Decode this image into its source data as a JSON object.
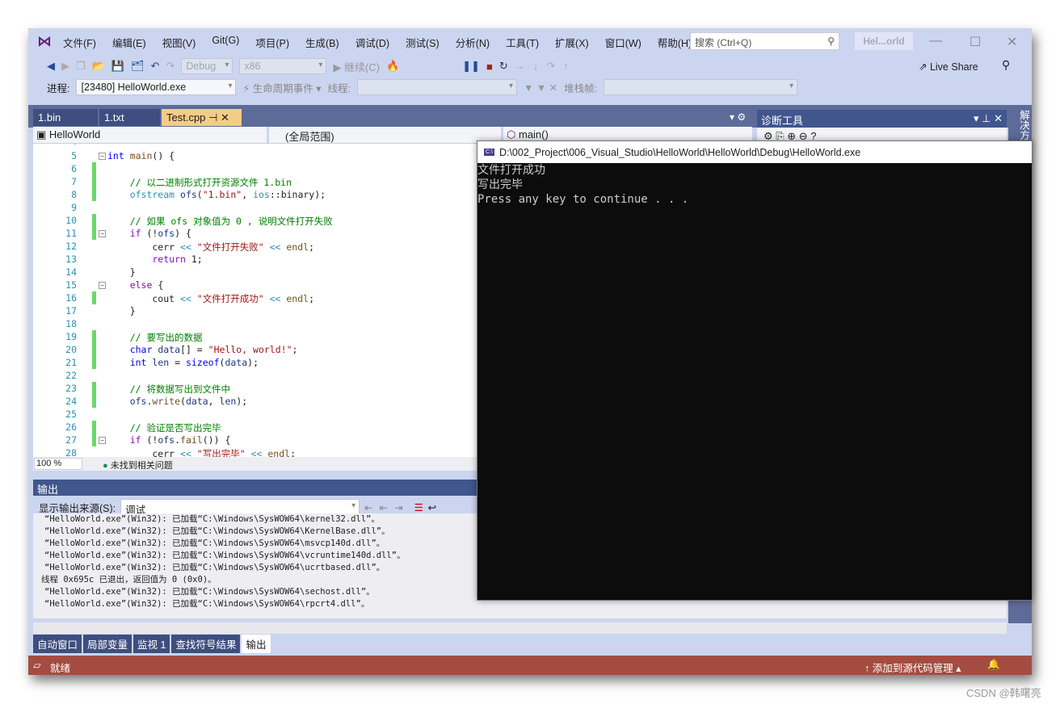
{
  "menu": [
    "文件(F)",
    "编辑(E)",
    "视图(V)",
    "Git(G)",
    "项目(P)",
    "生成(B)",
    "调试(D)",
    "测试(S)",
    "分析(N)",
    "工具(T)",
    "扩展(X)",
    "窗口(W)",
    "帮助(H)"
  ],
  "search": {
    "placeholder": "搜索 (Ctrl+Q)"
  },
  "window_title": "Hel...orld",
  "toolbar": {
    "config": "Debug",
    "platform": "x86",
    "continue": "继续(C)",
    "live_share": "Live Share"
  },
  "debug_bar": {
    "process_label": "进程:",
    "process": "[23480] HelloWorld.exe",
    "lifecycle": "生命周期事件",
    "thread_label": "线程:",
    "stack_label": "堆栈帧:"
  },
  "tabs": [
    {
      "label": "1.bin"
    },
    {
      "label": "1.txt"
    },
    {
      "label": "Test.cpp",
      "active": true
    }
  ],
  "nav": {
    "project": "HelloWorld",
    "scope": "(全局范围)",
    "member": "main()"
  },
  "code": [
    {
      "n": "5",
      "t": [
        [
          "kw",
          "int"
        ],
        [
          "",
          ""
        ],
        [
          "fn",
          " main"
        ],
        [
          "",
          "() {"
        ]
      ]
    },
    {
      "n": "6",
      "t": []
    },
    {
      "n": "7",
      "t": [
        [
          "cm",
          "    // 以二进制形式打开资源文件 1.bin"
        ]
      ]
    },
    {
      "n": "8",
      "t": [
        [
          "ty",
          "    ofstream"
        ],
        [
          "vr",
          " ofs"
        ],
        [
          "",
          "("
        ],
        [
          "st",
          "\"1.bin\""
        ],
        [
          "",
          ", "
        ],
        [
          "ty",
          "ios"
        ],
        [
          "",
          "::binary);"
        ]
      ]
    },
    {
      "n": "9",
      "t": []
    },
    {
      "n": "10",
      "t": [
        [
          "cm",
          "    // 如果 ofs 对象值为 0 , 说明文件打开失败"
        ]
      ]
    },
    {
      "n": "11",
      "t": [
        [
          "pp",
          "    if"
        ],
        [
          "",
          " (!"
        ],
        [
          "vr",
          "ofs"
        ],
        [
          "",
          ") {"
        ]
      ]
    },
    {
      "n": "12",
      "t": [
        [
          "",
          "        cerr "
        ],
        [
          "ty",
          "<<"
        ],
        [
          "st",
          " \"文件打开失败\""
        ],
        [
          "ty",
          " <<"
        ],
        [
          "fn",
          " endl"
        ],
        [
          "",
          ";"
        ]
      ]
    },
    {
      "n": "13",
      "t": [
        [
          "pp",
          "        return"
        ],
        [
          "",
          " 1;"
        ]
      ]
    },
    {
      "n": "14",
      "t": [
        [
          "",
          "    }"
        ]
      ]
    },
    {
      "n": "15",
      "t": [
        [
          "pp",
          "    else"
        ],
        [
          "",
          " {"
        ]
      ]
    },
    {
      "n": "16",
      "t": [
        [
          "",
          "        cout "
        ],
        [
          "ty",
          "<<"
        ],
        [
          "st",
          " \"文件打开成功\""
        ],
        [
          "ty",
          " <<"
        ],
        [
          "fn",
          " endl"
        ],
        [
          "",
          ";"
        ]
      ]
    },
    {
      "n": "17",
      "t": [
        [
          "",
          "    }"
        ]
      ]
    },
    {
      "n": "18",
      "t": []
    },
    {
      "n": "19",
      "t": [
        [
          "cm",
          "    // 要写出的数据"
        ]
      ]
    },
    {
      "n": "20",
      "t": [
        [
          "kw",
          "    char"
        ],
        [
          "vr",
          " data"
        ],
        [
          "",
          "[] = "
        ],
        [
          "st",
          "\"Hello, world!\""
        ],
        [
          "",
          ";"
        ]
      ]
    },
    {
      "n": "21",
      "t": [
        [
          "kw",
          "    int"
        ],
        [
          "vr",
          " len"
        ],
        [
          "",
          " = "
        ],
        [
          "kw",
          "sizeof"
        ],
        [
          "",
          "("
        ],
        [
          "vr",
          "data"
        ],
        [
          "",
          ");"
        ]
      ]
    },
    {
      "n": "22",
      "t": []
    },
    {
      "n": "23",
      "t": [
        [
          "cm",
          "    // 将数据写出到文件中"
        ]
      ]
    },
    {
      "n": "24",
      "t": [
        [
          "vr",
          "    ofs"
        ],
        [
          "",
          "."
        ],
        [
          "fn",
          "write"
        ],
        [
          "",
          "("
        ],
        [
          "vr",
          "data"
        ],
        [
          "",
          ", "
        ],
        [
          "vr",
          "len"
        ],
        [
          "",
          ");"
        ]
      ]
    },
    {
      "n": "25",
      "t": []
    },
    {
      "n": "26",
      "t": [
        [
          "cm",
          "    // 验证是否写出完毕"
        ]
      ]
    },
    {
      "n": "27",
      "t": [
        [
          "pp",
          "    if"
        ],
        [
          "",
          " (!"
        ],
        [
          "vr",
          "ofs"
        ],
        [
          "",
          "."
        ],
        [
          "fn",
          "fail"
        ],
        [
          "",
          "()) {"
        ]
      ]
    },
    {
      "n": "28",
      "t": [
        [
          "",
          "        cerr "
        ],
        [
          "ty",
          "<<"
        ],
        [
          "st",
          " \"写出完毕\""
        ],
        [
          "ty",
          " <<"
        ],
        [
          "fn",
          " endl"
        ],
        [
          "",
          ";"
        ]
      ]
    }
  ],
  "editor_status": {
    "zoom": "100 %",
    "issues": "未找到相关问题"
  },
  "output": {
    "title": "输出",
    "source_label": "显示输出来源(S):",
    "source": "调试",
    "lines": [
      "“HelloWorld.exe”(Win32): 已加载“C:\\Windows\\SysWOW64\\kernel32.dll”。",
      "“HelloWorld.exe”(Win32): 已加载“C:\\Windows\\SysWOW64\\KernelBase.dll”。",
      "“HelloWorld.exe”(Win32): 已加载“C:\\Windows\\SysWOW64\\msvcp140d.dll”。",
      "“HelloWorld.exe”(Win32): 已加载“C:\\Windows\\SysWOW64\\vcruntime140d.dll”。",
      "“HelloWorld.exe”(Win32): 已加载“C:\\Windows\\SysWOW64\\ucrtbased.dll”。",
      "线程 0x695c 已退出，返回值为 0 (0x0)。",
      "“HelloWorld.exe”(Win32): 已加载“C:\\Windows\\SysWOW64\\sechost.dll”。",
      "“HelloWorld.exe”(Win32): 已加载“C:\\Windows\\SysWOW64\\rpcrt4.dll”。"
    ]
  },
  "bottom_tabs": [
    "自动窗口",
    "局部变量",
    "监视 1",
    "查找符号结果",
    "输出"
  ],
  "status": {
    "ready": "就绪",
    "scm": "添加到源代码管理",
    "color": "#a44c41"
  },
  "diag": {
    "title": "诊断工具"
  },
  "solution": "解决方案",
  "console": {
    "title": "D:\\002_Project\\006_Visual_Studio\\HelloWorld\\HelloWorld\\Debug\\HelloWorld.exe",
    "lines": [
      "文件打开成功",
      "写出完毕",
      "Press any key to continue . . ."
    ]
  },
  "watermark": "CSDN @韩曙亮"
}
